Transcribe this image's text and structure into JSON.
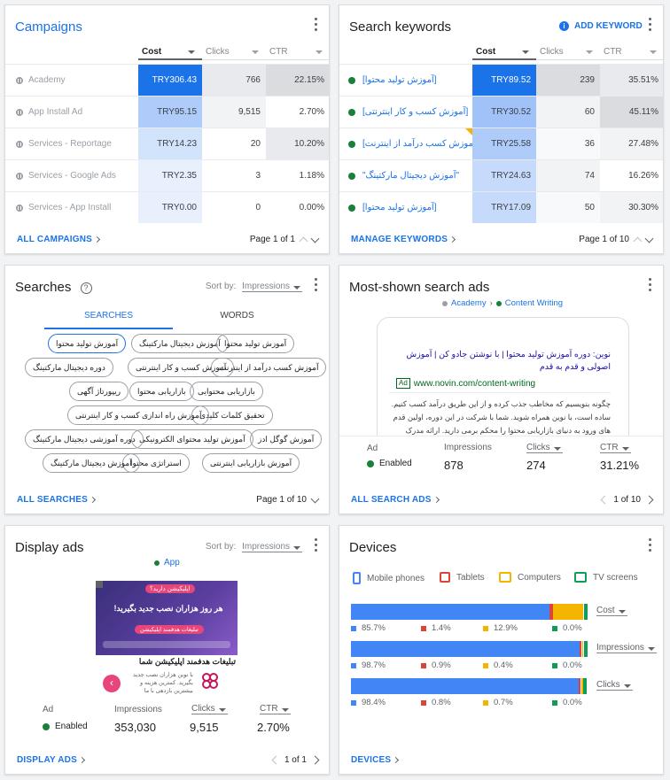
{
  "campaigns": {
    "title": "Campaigns",
    "columns": [
      "Cost",
      "Clicks",
      "CTR"
    ],
    "rows": [
      {
        "name": "Academy",
        "cost": "TRY306.43",
        "clicks": "766",
        "ctr": "22.15%"
      },
      {
        "name": "App Install Ad",
        "cost": "TRY95.15",
        "clicks": "9,515",
        "ctr": "2.70%"
      },
      {
        "name": "Services - Reportage",
        "cost": "TRY14.23",
        "clicks": "20",
        "ctr": "10.20%"
      },
      {
        "name": "Services - Google Ads",
        "cost": "TRY2.35",
        "clicks": "3",
        "ctr": "1.18%"
      },
      {
        "name": "Services - App Install",
        "cost": "TRY0.00",
        "clicks": "0",
        "ctr": "0.00%"
      }
    ],
    "footer_link": "ALL CAMPAIGNS",
    "page": "Page 1 of 1"
  },
  "keywords": {
    "title": "Search keywords",
    "add_label": "ADD KEYWORD",
    "columns": [
      "Cost",
      "Clicks",
      "CTR"
    ],
    "rows": [
      {
        "keyword": "[آموزش تولید محتوا]",
        "cost": "TRY89.52",
        "clicks": "239",
        "ctr": "35.51%"
      },
      {
        "keyword": "[آموزش کسب و کار اینترنتی]",
        "cost": "TRY30.52",
        "clicks": "60",
        "ctr": "45.11%"
      },
      {
        "keyword": "[آموزش کسب درآمد از اینترنت]",
        "cost": "TRY25.58",
        "clicks": "36",
        "ctr": "27.48%"
      },
      {
        "keyword": "\"آموزش دیجیتال مارکتینگ\"",
        "cost": "TRY24.63",
        "clicks": "74",
        "ctr": "16.26%"
      },
      {
        "keyword": "[آموزش تولید محتوا]",
        "cost": "TRY17.09",
        "clicks": "50",
        "ctr": "30.30%"
      }
    ],
    "footer_link": "MANAGE KEYWORDS",
    "page": "Page 1 of 10"
  },
  "searches": {
    "title": "Searches",
    "sort_label": "Sort by:",
    "sort_value": "Impressions",
    "tabs": [
      "SEARCHES",
      "WORDS"
    ],
    "chips": [
      "آموزش تولید محتوا",
      "آموزش دیجیتال مارکتینگ",
      "آموزش تولید محتوا",
      "آموزش کسب درآمد از اینترنت",
      "آموزش کسب و کار اینترنتی",
      "دوره دیجیتال مارکتینگ",
      "بازاریابی محتوایی",
      "بازاریابی محتوا",
      "ریپورتاژ آگهی",
      "تحقیق کلمات کلیدی",
      "آموزش راه اندازی کسب و کار اینترنتی",
      "آموزش گوگل ادز",
      "آموزش تولید محتوای الکترونیکی",
      "دوره آموزشی دیجیتال مارکتینگ",
      "آموزش بازاریابی اینترنتی",
      "استراتژی محتوا",
      "آموزش دیجیتال مارکتینگ"
    ],
    "footer_link": "ALL SEARCHES",
    "page": "Page 1 of 10"
  },
  "search_ads": {
    "title": "Most-shown search ads",
    "campaign": "Academy",
    "adgroup": "Content Writing",
    "ad_title": "نوین: دوره آموزش تولید محتوا | با نوشتن جادو کن | آموزش اصولی و قدم به قدم",
    "ad_badge": "Ad",
    "ad_url": "www.novin.com/content-writing",
    "ad_body": "چگونه بنویسیم که مخاطب جذب کرده و از این طریق درآمد کسب کنیم. ساده است، با نوین همراه شوید. شما با شرکت در این دوره، اولین قدم های ورود به دنیای بازاریابی محتوا را محکم برمی دارید. ارائه مدرک",
    "stat_labels": [
      "Ad",
      "Impressions",
      "Clicks",
      "CTR"
    ],
    "status": "Enabled",
    "impressions": "878",
    "clicks": "274",
    "ctr": "31.21%",
    "footer_link": "ALL SEARCH ADS",
    "page": "1 of 10"
  },
  "display_ads": {
    "title": "Display ads",
    "sort_label": "Sort by:",
    "sort_value": "Impressions",
    "campaign": "App",
    "banner_top": "اپلیکیشن دارید؟",
    "banner_main": "هر روز هزاران نصب جدید بگیرید!",
    "banner_cta": "تبلیغات هدفمند اپلیکیشن",
    "caption": "تبلیغات هدفمند اپلیکیشن شما",
    "caption_sub": "با نوین هزاران نصب جدید بگیرید. کمترین هزینه و بیشترین بازدهی با ما",
    "stat_labels": [
      "Ad",
      "Impressions",
      "Clicks",
      "CTR"
    ],
    "status": "Enabled",
    "impressions": "353,030",
    "clicks": "9,515",
    "ctr": "2.70%",
    "footer_link": "DISPLAY ADS",
    "page": "1 of 1"
  },
  "devices": {
    "title": "Devices",
    "legend": [
      "Mobile phones",
      "Tablets",
      "Computers",
      "TV screens"
    ],
    "colors": {
      "mobile": "#4285f4",
      "tablet": "#db4437",
      "computer": "#f4b400",
      "tv": "#0f9d58"
    },
    "metrics": [
      {
        "name": "Cost",
        "values": [
          85.7,
          1.4,
          12.9,
          0.0
        ],
        "labels": [
          "85.7%",
          "1.4%",
          "12.9%",
          "0.0%"
        ]
      },
      {
        "name": "Impressions",
        "values": [
          98.7,
          0.9,
          0.4,
          0.0
        ],
        "labels": [
          "98.7%",
          "0.9%",
          "0.4%",
          "0.0%"
        ]
      },
      {
        "name": "Clicks",
        "values": [
          98.4,
          0.8,
          0.7,
          0.0
        ],
        "labels": [
          "98.4%",
          "0.8%",
          "0.7%",
          "0.0%"
        ]
      }
    ],
    "footer_link": "DEVICES"
  }
}
